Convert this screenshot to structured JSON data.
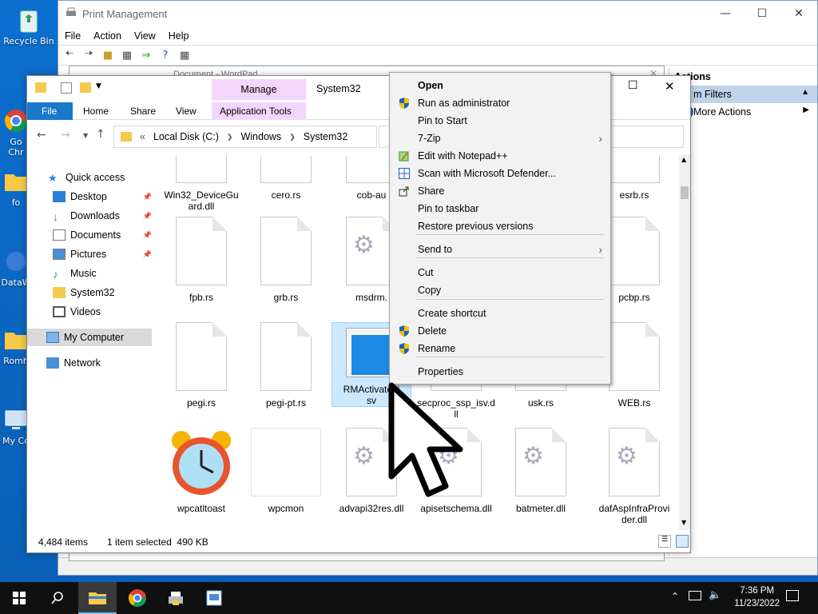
{
  "desktop": {
    "icons": [
      {
        "label": "Recycle Bin"
      },
      {
        "label": "Go\nChr"
      },
      {
        "label": "fo"
      },
      {
        "label": "DataW"
      },
      {
        "label": "Romh"
      },
      {
        "label": "My Co"
      }
    ]
  },
  "print_management": {
    "title": "Print Management",
    "menu": [
      "File",
      "Action",
      "View",
      "Help"
    ],
    "actions_header": "Actions",
    "actions_filter": "m Filters",
    "more_actions": "More Actions"
  },
  "wordpad": {
    "title": "Document - WordPad"
  },
  "explorer": {
    "title": "System32",
    "contextual_group": "Manage",
    "tabs": [
      "File",
      "Home",
      "Share",
      "View",
      "Application Tools"
    ],
    "breadcrumb": [
      "Local Disk (C:)",
      "Windows",
      "System32"
    ],
    "nav": [
      {
        "label": "Quick access"
      },
      {
        "label": "Desktop"
      },
      {
        "label": "Downloads"
      },
      {
        "label": "Documents"
      },
      {
        "label": "Pictures"
      },
      {
        "label": "Music"
      },
      {
        "label": "System32"
      },
      {
        "label": "Videos"
      },
      {
        "label": "My Computer"
      },
      {
        "label": "Network"
      }
    ],
    "files": [
      {
        "name": "Win32_DeviceGu\nard.dll",
        "type": "dll"
      },
      {
        "name": "cero.rs",
        "type": "doc"
      },
      {
        "name": "cob-au",
        "type": "doc"
      },
      {
        "name": "",
        "type": "doc"
      },
      {
        "name": "",
        "type": "doc"
      },
      {
        "name": "esrb.rs",
        "type": "doc"
      },
      {
        "name": "fpb.rs",
        "type": "doc"
      },
      {
        "name": "grb.rs",
        "type": "doc"
      },
      {
        "name": "msdrm.",
        "type": "dll"
      },
      {
        "name": "",
        "type": "doc"
      },
      {
        "name": "",
        "type": "doc"
      },
      {
        "name": "pcbp.rs",
        "type": "doc"
      },
      {
        "name": "pegi.rs",
        "type": "doc"
      },
      {
        "name": "pegi-pt.rs",
        "type": "doc"
      },
      {
        "name": "RMActivate_i\nsv",
        "type": "app"
      },
      {
        "name": "secproc_ssp_isv.d\nll",
        "type": "doc"
      },
      {
        "name": "usk.rs",
        "type": "doc"
      },
      {
        "name": "WEB.rs",
        "type": "doc"
      },
      {
        "name": "wpcatltoast",
        "type": "clock"
      },
      {
        "name": "wpcmon",
        "type": "blank"
      },
      {
        "name": "advapi32res.dll",
        "type": "dll"
      },
      {
        "name": "apisetschema.dll",
        "type": "dll"
      },
      {
        "name": "batmeter.dll",
        "type": "dll"
      },
      {
        "name": "dafAspInfraProvi\nder.dll",
        "type": "dll"
      }
    ],
    "status_count": "4,484 items",
    "status_selected": "1 item selected  490 KB"
  },
  "context_menu": {
    "items": [
      {
        "label": "Open",
        "bold": true
      },
      {
        "label": "Run as administrator",
        "icon": "shield-icon"
      },
      {
        "label": "Pin to Start"
      },
      {
        "label": "7-Zip",
        "submenu": true
      },
      {
        "label": "Edit with Notepad++",
        "icon": "notepadpp-icon"
      },
      {
        "label": "Scan with Microsoft Defender...",
        "icon": "defender-icon"
      },
      {
        "label": "Share",
        "icon": "share-icon"
      },
      {
        "label": "Pin to taskbar"
      },
      {
        "label": "Restore previous versions"
      },
      {
        "label": "Send to",
        "submenu": true
      },
      {
        "label": "Cut"
      },
      {
        "label": "Copy"
      },
      {
        "label": "Create shortcut"
      },
      {
        "label": "Delete",
        "icon": "shield-icon"
      },
      {
        "label": "Rename",
        "icon": "shield-icon"
      },
      {
        "label": "Properties"
      }
    ]
  },
  "taskbar": {
    "time": "7:36 PM",
    "date": "11/23/2022"
  },
  "colors": {
    "desktop": "#0a63b8",
    "file_tab": "#1979ca",
    "manage_tab": "#f3d6fb",
    "selection": "#cce8ff",
    "taskbar": "#101010"
  }
}
